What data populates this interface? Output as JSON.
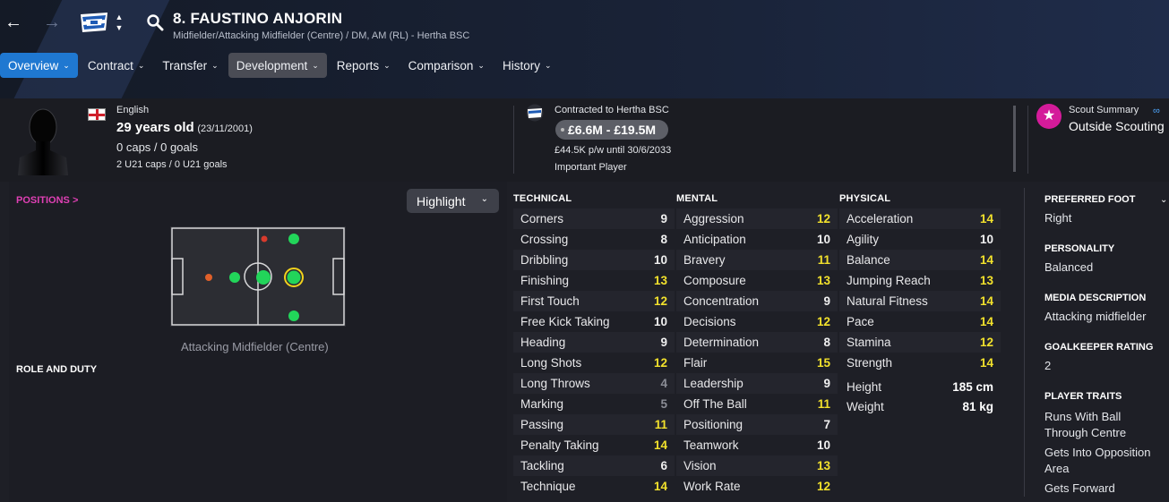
{
  "header": {
    "player_name": "8. FAUSTINO ANJORIN",
    "player_subtitle": "Midfielder/Attacking Midfielder (Centre) / DM, AM (RL) - Hertha BSC",
    "tabs": [
      {
        "label": "Overview"
      },
      {
        "label": "Contract"
      },
      {
        "label": "Transfer"
      },
      {
        "label": "Development"
      },
      {
        "label": "Reports"
      },
      {
        "label": "Comparison"
      },
      {
        "label": "History"
      }
    ],
    "active_tab": "Overview"
  },
  "bio": {
    "nationality": "English",
    "age": "29 years old",
    "dob": "(23/11/2001)",
    "caps": "0 caps / 0 goals",
    "u21": "2 U21 caps / 0 U21 goals"
  },
  "contract": {
    "club": "Contracted to Hertha BSC",
    "value_range": "£6.6M - £19.5M",
    "wage": "£44.5K p/w until 30/6/2033",
    "status": "Important Player"
  },
  "scout": {
    "title": "Scout Summary",
    "value": "Outside Scouting"
  },
  "positions": {
    "link_label": "POSITIONS >",
    "highlight_label": "Highlight",
    "caption": "Attacking Midfielder (Centre)",
    "role_duty_label": "ROLE AND DUTY"
  },
  "attributes": {
    "technical": {
      "title": "TECHNICAL",
      "rows": [
        {
          "name": "Corners",
          "value": "9",
          "tone": "white"
        },
        {
          "name": "Crossing",
          "value": "8",
          "tone": "white"
        },
        {
          "name": "Dribbling",
          "value": "10",
          "tone": "white"
        },
        {
          "name": "Finishing",
          "value": "13",
          "tone": "yellow"
        },
        {
          "name": "First Touch",
          "value": "12",
          "tone": "yellow"
        },
        {
          "name": "Free Kick Taking",
          "value": "10",
          "tone": "white"
        },
        {
          "name": "Heading",
          "value": "9",
          "tone": "white"
        },
        {
          "name": "Long Shots",
          "value": "12",
          "tone": "yellow"
        },
        {
          "name": "Long Throws",
          "value": "4",
          "tone": "grey"
        },
        {
          "name": "Marking",
          "value": "5",
          "tone": "grey"
        },
        {
          "name": "Passing",
          "value": "11",
          "tone": "yellow"
        },
        {
          "name": "Penalty Taking",
          "value": "14",
          "tone": "yellow"
        },
        {
          "name": "Tackling",
          "value": "6",
          "tone": "white"
        },
        {
          "name": "Technique",
          "value": "14",
          "tone": "yellow"
        }
      ]
    },
    "mental": {
      "title": "MENTAL",
      "rows": [
        {
          "name": "Aggression",
          "value": "12",
          "tone": "yellow"
        },
        {
          "name": "Anticipation",
          "value": "10",
          "tone": "white"
        },
        {
          "name": "Bravery",
          "value": "11",
          "tone": "yellow"
        },
        {
          "name": "Composure",
          "value": "13",
          "tone": "yellow"
        },
        {
          "name": "Concentration",
          "value": "9",
          "tone": "white"
        },
        {
          "name": "Decisions",
          "value": "12",
          "tone": "yellow"
        },
        {
          "name": "Determination",
          "value": "8",
          "tone": "white"
        },
        {
          "name": "Flair",
          "value": "15",
          "tone": "yellow"
        },
        {
          "name": "Leadership",
          "value": "9",
          "tone": "white"
        },
        {
          "name": "Off The Ball",
          "value": "11",
          "tone": "yellow"
        },
        {
          "name": "Positioning",
          "value": "7",
          "tone": "white"
        },
        {
          "name": "Teamwork",
          "value": "10",
          "tone": "white"
        },
        {
          "name": "Vision",
          "value": "13",
          "tone": "yellow"
        },
        {
          "name": "Work Rate",
          "value": "12",
          "tone": "yellow"
        }
      ]
    },
    "physical": {
      "title": "PHYSICAL",
      "rows": [
        {
          "name": "Acceleration",
          "value": "14",
          "tone": "yellow"
        },
        {
          "name": "Agility",
          "value": "10",
          "tone": "white"
        },
        {
          "name": "Balance",
          "value": "14",
          "tone": "yellow"
        },
        {
          "name": "Jumping Reach",
          "value": "13",
          "tone": "yellow"
        },
        {
          "name": "Natural Fitness",
          "value": "14",
          "tone": "yellow"
        },
        {
          "name": "Pace",
          "value": "14",
          "tone": "yellow"
        },
        {
          "name": "Stamina",
          "value": "12",
          "tone": "yellow"
        },
        {
          "name": "Strength",
          "value": "14",
          "tone": "yellow"
        }
      ],
      "height_label": "Height",
      "height": "185 cm",
      "weight_label": "Weight",
      "weight": "81 kg"
    }
  },
  "side": {
    "preferred_foot_label": "PREFERRED FOOT",
    "preferred_foot": "Right",
    "personality_label": "PERSONALITY",
    "personality": "Balanced",
    "media_label": "MEDIA DESCRIPTION",
    "media": "Attacking midfielder",
    "gk_label": "GOALKEEPER RATING",
    "gk": "2",
    "traits_label": "PLAYER TRAITS",
    "traits": [
      "Runs With Ball",
      "Through Centre",
      "Gets Into Opposition",
      "Area",
      "Gets Forward"
    ]
  },
  "colors": {
    "accent": "#1f78d1",
    "highlight_value": "#f2e12c",
    "positions_link": "#e040b5"
  }
}
